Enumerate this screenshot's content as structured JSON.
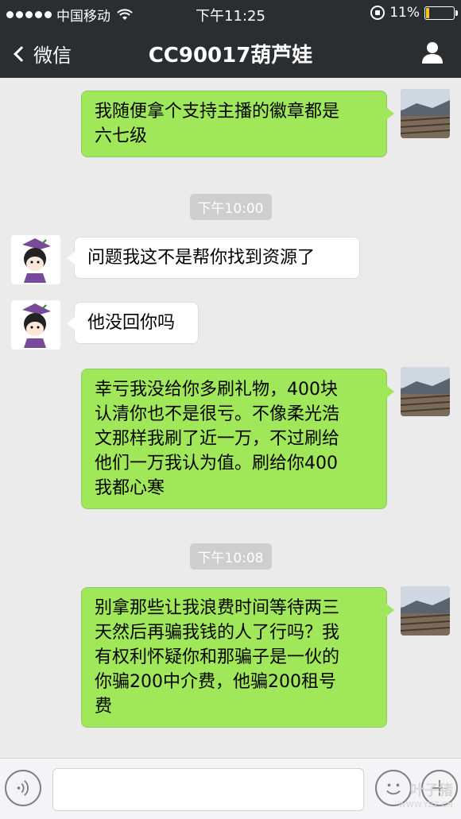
{
  "status_bar": {
    "carrier": "中国移动",
    "time": "下午11:25",
    "battery_percent": "11%",
    "battery_level": 0.11
  },
  "nav": {
    "back_label": "微信",
    "title": "CC90017葫芦娃"
  },
  "messages": [
    {
      "side": "self",
      "text_lines": [
        "我随便拿个支持主播的徽章都是",
        "六七级"
      ]
    },
    {
      "type": "time",
      "text": "下午10:00"
    },
    {
      "side": "other",
      "text_lines": [
        "问题我这不是帮你找到资源了"
      ]
    },
    {
      "side": "other",
      "text_lines": [
        "他没回你吗"
      ]
    },
    {
      "side": "self",
      "text_lines": [
        "幸亏我没给你多刷礼物，400块",
        "认清你也不是很亏。不像柔光浩",
        "文那样我刷了近一万，不过刷给",
        "他们一万我认为值。刷给你400",
        "我都心寒"
      ]
    },
    {
      "type": "time",
      "text": "下午10:08"
    },
    {
      "side": "self",
      "text_lines": [
        "别拿那些让我浪费时间等待两三",
        "天然后再骗我钱的人了行吗？我",
        "有权利怀疑你和那骗子是一伙的",
        "你骗200中介费，他骗200租号",
        "费"
      ]
    }
  ],
  "watermark": {
    "text": "叶子猪",
    "url": "WWW.YZZ.CN"
  },
  "icons": {
    "wifi": "wifi-icon",
    "rotation_lock": "rotation-lock-icon",
    "battery": "battery-icon",
    "back": "chevron-left-icon",
    "user": "user-icon",
    "voice": "voice-icon",
    "emoji": "emoji-icon",
    "plus": "plus-icon"
  },
  "colors": {
    "bar_bg": "#2b2e30",
    "chat_bg": "#ebebeb",
    "self_bubble": "#a0e75a",
    "other_bubble": "#ffffff",
    "battery_fill": "#f5c518"
  }
}
